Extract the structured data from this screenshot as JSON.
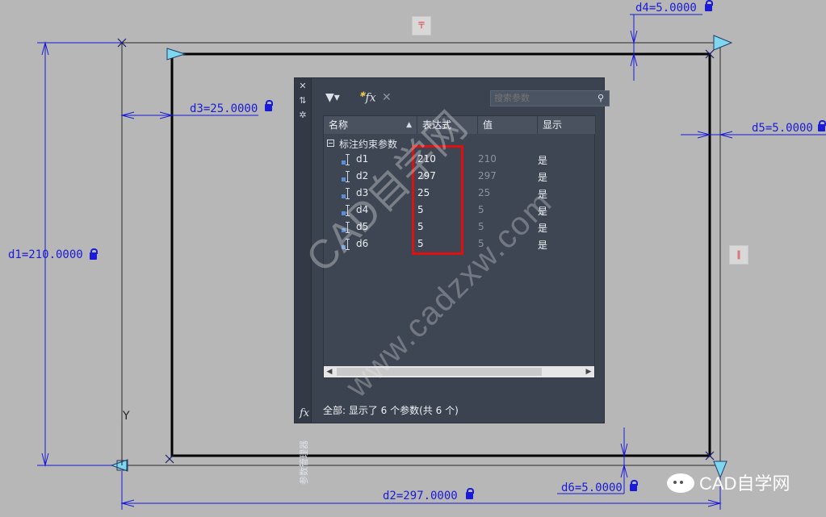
{
  "drawing": {
    "dimensions": [
      {
        "id": "d1",
        "text": "d1=210.0000"
      },
      {
        "id": "d2",
        "text": "d2=297.0000"
      },
      {
        "id": "d3",
        "text": "d3=25.0000"
      },
      {
        "id": "d4",
        "text": "d4=5.0000"
      },
      {
        "id": "d5",
        "text": "d5=5.0000"
      },
      {
        "id": "d6",
        "text": "d6=5.0000"
      }
    ],
    "ucs_label": "Y",
    "colors": {
      "dimension": "#1a1ad8",
      "frame": "#000000",
      "background": "#b7b7b7"
    }
  },
  "palette": {
    "side_title": "参数管理器",
    "fx_label": "fx",
    "toolbar": {
      "filter_icon": "filter-icon",
      "new_param_icon": "fx",
      "delete_icon": "delete-icon"
    },
    "search": {
      "placeholder": "搜索参数"
    },
    "columns": [
      "名称",
      "表达式",
      "值",
      "显示"
    ],
    "group_label": "标注约束参数",
    "params": [
      {
        "name": "d1",
        "expression": "210",
        "value": "210",
        "show": "是"
      },
      {
        "name": "d2",
        "expression": "297",
        "value": "297",
        "show": "是"
      },
      {
        "name": "d3",
        "expression": "25",
        "value": "25",
        "show": "是"
      },
      {
        "name": "d4",
        "expression": "5",
        "value": "5",
        "show": "是"
      },
      {
        "name": "d5",
        "expression": "5",
        "value": "5",
        "show": "是"
      },
      {
        "name": "d6",
        "expression": "5",
        "value": "5",
        "show": "是"
      }
    ],
    "status": "全部: 显示了 6 个参数(共 6 个)",
    "colors": {
      "panel": "#3b4350",
      "header": "#4a5260",
      "highlight": "#e01010"
    }
  },
  "watermark": {
    "line1": "CAD自学网",
    "line2": "www.cadzxw.com"
  },
  "brand": {
    "text": "CAD自学网"
  }
}
